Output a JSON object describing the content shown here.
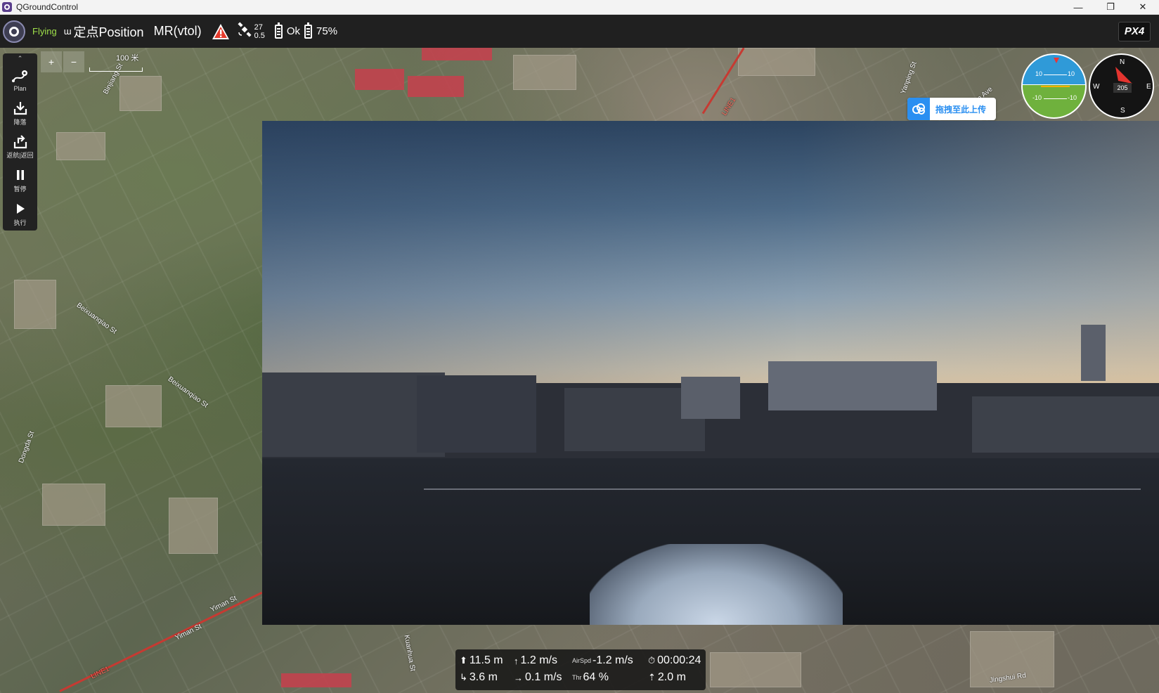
{
  "window": {
    "title": "QGroundControl",
    "buttons": {
      "minimize": "—",
      "restore": "❐",
      "close": "✕"
    }
  },
  "toolbar": {
    "flight_state": "Flying",
    "flight_mode": "定点Position",
    "vehicle_type": "MR(vtol)",
    "gps_satellites": "27",
    "gps_hdop": "0.5",
    "rc_status": "Ok",
    "battery_percent": "75%",
    "brand": "PX4"
  },
  "map": {
    "scale_label": "100 米",
    "zoom_in": "+",
    "zoom_out": "−",
    "street_labels": [
      "Binjiang St",
      "Beixuanqiao St",
      "Beixuanqiao St",
      "Yiman St",
      "Yiman St",
      "LINE1",
      "LINE1",
      "Kuanhua St",
      "Taian Ave",
      "Yanping St",
      "Dongda St",
      "Jingshui Rd"
    ]
  },
  "toolstrip": {
    "collapse": "⌃",
    "items": [
      {
        "label": "Plan",
        "icon": "plan-icon"
      },
      {
        "label": "降落",
        "icon": "land-icon"
      },
      {
        "label": "返航|返回",
        "icon": "rtl-icon"
      },
      {
        "label": "暂停",
        "icon": "pause-icon"
      },
      {
        "label": "执行",
        "icon": "play-icon"
      }
    ]
  },
  "upload": {
    "label": "拖拽至此上传",
    "color": "#2a8ff1"
  },
  "attitude": {
    "ticks": [
      "10",
      "10",
      "-10",
      "-10"
    ]
  },
  "compass": {
    "north": "N",
    "south": "S",
    "east": "E",
    "west": "W",
    "heading": "205"
  },
  "telemetry": {
    "altitude": "11.5 m",
    "climb_rate": "1.2 m/s",
    "airspeed_prefix": "AirSpd",
    "airspeed": "-1.2 m/s",
    "flight_time": "00:00:24",
    "distance": "3.6 m",
    "ground_speed": "0.1 m/s",
    "throttle_prefix": "Thr",
    "throttle": "64 %",
    "home_distance": "2.0 m"
  },
  "colors": {
    "flying_state": "#9fe04a",
    "toolbar_bg": "#202020",
    "rail_line": "#c63a32"
  }
}
